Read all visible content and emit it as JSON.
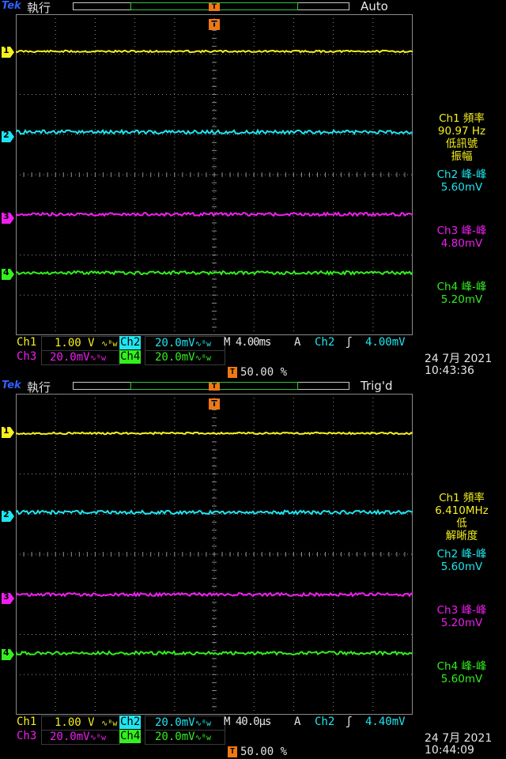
{
  "colors": {
    "ch1": "#f5f01e",
    "ch2": "#1ee6f0",
    "ch3": "#f01ef0",
    "ch4": "#32f01e",
    "brand": "#3060ff",
    "trigger": "#f07814",
    "grid": "#8a8a8a"
  },
  "panels": [
    {
      "brand": "Tek",
      "run_state": "執行",
      "trigger_mode": "Auto",
      "measurements": {
        "ch1": [
          "Ch1 頻率",
          "90.97 Hz",
          "低訊號",
          "振幅"
        ],
        "ch2": [
          "Ch2 峰-峰",
          "5.60mV"
        ],
        "ch3": [
          "Ch3 峰-峰",
          "4.80mV"
        ],
        "ch4": [
          "Ch4 峰-峰",
          "5.20mV"
        ]
      },
      "status": {
        "ch1_label": "Ch1",
        "ch1_scale": "1.00 V",
        "ch2_label": "Ch2",
        "ch2_scale": "20.0mV",
        "ch3_label": "Ch3",
        "ch3_scale": "20.0mV",
        "ch4_label": "Ch4",
        "ch4_scale": "20.0mV",
        "bw_icon": "∿ᴮw",
        "timebase": "M 4.00ms",
        "acq": "A",
        "trig_src": "Ch2",
        "trig_slope_icon": "rising-edge-icon",
        "trig_slope_glyph": "ʃ",
        "trig_level": "4.00mV",
        "trig_pos": "50.00 %",
        "date": "24 7月  2021",
        "time": "10:43:36"
      },
      "channel_markers": [
        "1",
        "2",
        "3",
        "4"
      ]
    },
    {
      "brand": "Tek",
      "run_state": "執行",
      "trigger_mode": "Trig'd",
      "measurements": {
        "ch1": [
          "Ch1 頻率",
          "6.410MHz",
          "低",
          "解晰度"
        ],
        "ch2": [
          "Ch2 峰-峰",
          "5.60mV"
        ],
        "ch3": [
          "Ch3 峰-峰",
          "5.20mV"
        ],
        "ch4": [
          "Ch4 峰-峰",
          "5.60mV"
        ]
      },
      "status": {
        "ch1_label": "Ch1",
        "ch1_scale": "1.00 V",
        "ch2_label": "Ch2",
        "ch2_scale": "20.0mV",
        "ch3_label": "Ch3",
        "ch3_scale": "20.0mV",
        "ch4_label": "Ch4",
        "ch4_scale": "20.0mV",
        "bw_icon": "∿ᴮw",
        "timebase": "M 40.0µs",
        "acq": "A",
        "trig_src": "Ch2",
        "trig_slope_icon": "rising-edge-icon",
        "trig_slope_glyph": "ʃ",
        "trig_level": "4.40mV",
        "trig_pos": "50.00 %",
        "date": "24 7月  2021",
        "time": "10:44:09"
      },
      "channel_markers": [
        "1",
        "2",
        "3",
        "4"
      ]
    }
  ]
}
